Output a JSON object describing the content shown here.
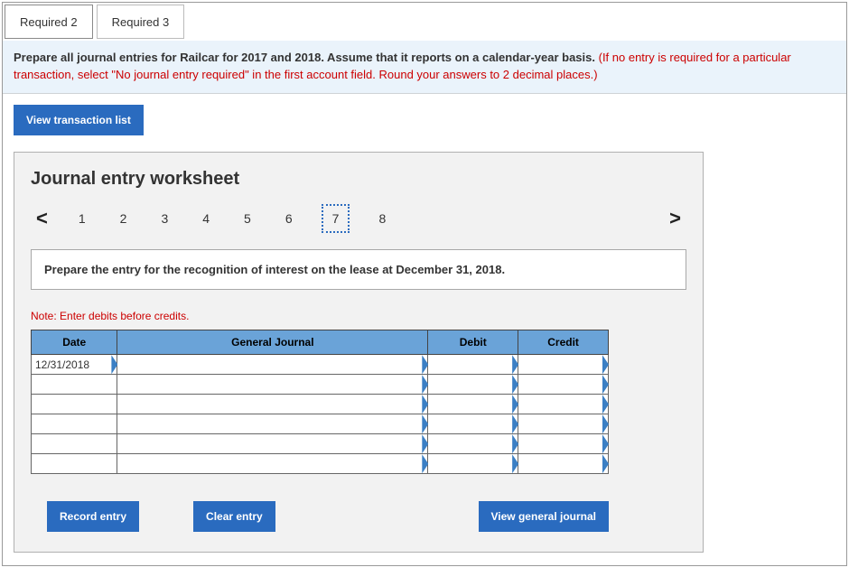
{
  "tabs": {
    "t1": "Required 2",
    "t2": "Required 3"
  },
  "instructions": {
    "main": "Prepare all journal entries for Railcar for 2017 and 2018. Assume that it reports on a calendar-year basis. ",
    "hint": "(If no entry is required for a particular transaction, select \"No journal entry required\" in the first account field. Round your answers to 2 decimal places.)"
  },
  "buttons": {
    "view_list": "View transaction list",
    "record": "Record entry",
    "clear": "Clear entry",
    "view_journal": "View general journal"
  },
  "worksheet": {
    "title": "Journal entry worksheet",
    "pages": [
      "1",
      "2",
      "3",
      "4",
      "5",
      "6",
      "7",
      "8"
    ],
    "current_page": "7",
    "prompt": "Prepare the entry for the recognition of interest on the lease at December 31, 2018.",
    "note": "Note: Enter debits before credits.",
    "headers": {
      "date": "Date",
      "gj": "General Journal",
      "debit": "Debit",
      "credit": "Credit"
    },
    "rows": [
      {
        "date": "12/31/2018",
        "gj": "",
        "debit": "",
        "credit": ""
      },
      {
        "date": "",
        "gj": "",
        "debit": "",
        "credit": ""
      },
      {
        "date": "",
        "gj": "",
        "debit": "",
        "credit": ""
      },
      {
        "date": "",
        "gj": "",
        "debit": "",
        "credit": ""
      },
      {
        "date": "",
        "gj": "",
        "debit": "",
        "credit": ""
      },
      {
        "date": "",
        "gj": "",
        "debit": "",
        "credit": ""
      }
    ]
  },
  "glyphs": {
    "prev": "<",
    "next": ">"
  }
}
